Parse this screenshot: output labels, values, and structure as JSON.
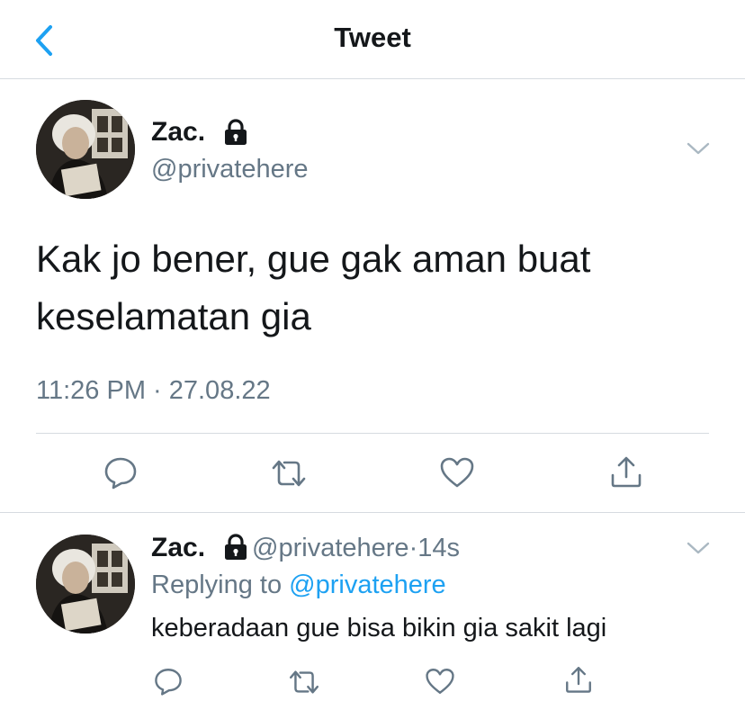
{
  "header": {
    "title": "Tweet"
  },
  "tweet": {
    "display_name": "Zac.",
    "handle": "@privatehere",
    "text_line1": "Kak jo bener, gue gak aman buat",
    "text_line2": "keselamatan gia",
    "timestamp": "11:26 PM · 27.08.22"
  },
  "reply": {
    "display_name": "Zac.",
    "handle": "@privatehere",
    "separator": "·",
    "time": "14s",
    "replying_prefix": "Replying to ",
    "replying_to": "@privatehere",
    "text": "keberadaan gue bisa bikin gia sakit lagi"
  },
  "colors": {
    "accent": "#1da1f2",
    "secondary_text": "#657786",
    "icon": "#657786",
    "divider": "#d6dbe0"
  },
  "icons": [
    "back-chevron-icon",
    "lock-icon",
    "chevron-down-icon",
    "reply-icon",
    "retweet-icon",
    "like-icon",
    "share-icon"
  ]
}
